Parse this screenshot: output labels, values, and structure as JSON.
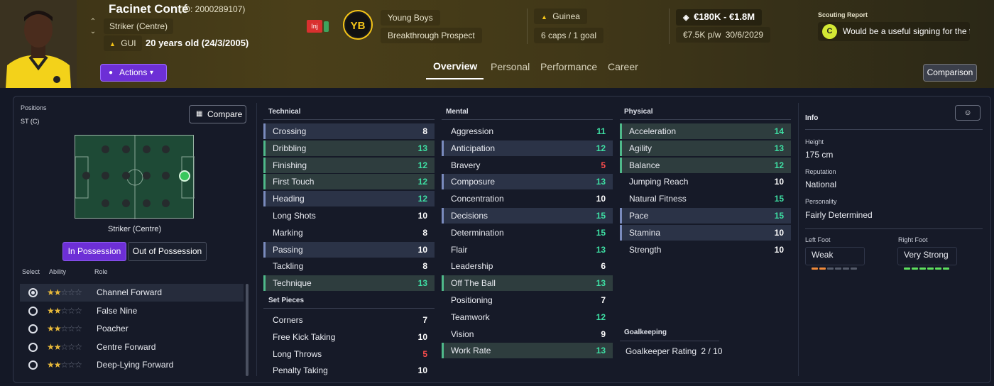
{
  "player": {
    "name": "Facinet Conté",
    "id_text": "(ID: 2000289107)",
    "position": "Striker (Centre)",
    "nationality_code": "GUI",
    "age_text": "20 years old (24/3/2005)",
    "injury_label": "Inj"
  },
  "club": {
    "name": "Young Boys",
    "status": "Breakthrough Prospect",
    "badge_text": "YB"
  },
  "international": {
    "country": "Guinea",
    "caps": "6 caps / 1 goal"
  },
  "contract": {
    "value": "€180K - €1.8M",
    "wage": "€7.5K p/w",
    "expires": "30/6/2029"
  },
  "scouting": {
    "title": "Scouting Report",
    "grade": "C",
    "summary": "Would be a useful signing for the f..."
  },
  "actions_label": "Actions",
  "tabs": [
    "Overview",
    "Personal",
    "Performance",
    "Career"
  ],
  "comparison_label": "Comparison",
  "positions": {
    "title": "Positions",
    "value": "ST (C)",
    "compare_label": "Compare",
    "pitch_caption": "Striker (Centre)",
    "in_possession": "In Possession",
    "out_possession": "Out of Possession",
    "headers": {
      "select": "Select",
      "ability": "Ability",
      "role": "Role"
    },
    "roles": [
      {
        "name": "Channel Forward",
        "stars": 2,
        "selected": true
      },
      {
        "name": "False Nine",
        "stars": 2,
        "selected": false
      },
      {
        "name": "Poacher",
        "stars": 2,
        "selected": false
      },
      {
        "name": "Centre Forward",
        "stars": 2,
        "selected": false
      },
      {
        "name": "Deep-Lying Forward",
        "stars": 2,
        "selected": false
      }
    ]
  },
  "attributes": {
    "technical_title": "Technical",
    "technical": [
      {
        "name": "Crossing",
        "value": "8",
        "hl": "b"
      },
      {
        "name": "Dribbling",
        "value": "13",
        "hl": "g"
      },
      {
        "name": "Finishing",
        "value": "12",
        "hl": "g"
      },
      {
        "name": "First Touch",
        "value": "12",
        "hl": "g"
      },
      {
        "name": "Heading",
        "value": "12",
        "hl": "b"
      },
      {
        "name": "Long Shots",
        "value": "10",
        "hl": ""
      },
      {
        "name": "Marking",
        "value": "8",
        "hl": ""
      },
      {
        "name": "Passing",
        "value": "10",
        "hl": "b"
      },
      {
        "name": "Tackling",
        "value": "8",
        "hl": ""
      },
      {
        "name": "Technique",
        "value": "13",
        "hl": "g"
      }
    ],
    "setpieces_title": "Set Pieces",
    "setpieces": [
      {
        "name": "Corners",
        "value": "7",
        "hl": ""
      },
      {
        "name": "Free Kick Taking",
        "value": "10",
        "hl": ""
      },
      {
        "name": "Long Throws",
        "value": "5",
        "hl": ""
      },
      {
        "name": "Penalty Taking",
        "value": "10",
        "hl": ""
      }
    ],
    "mental_title": "Mental",
    "mental": [
      {
        "name": "Aggression",
        "value": "11",
        "hl": ""
      },
      {
        "name": "Anticipation",
        "value": "12",
        "hl": "b"
      },
      {
        "name": "Bravery",
        "value": "5",
        "hl": ""
      },
      {
        "name": "Composure",
        "value": "13",
        "hl": "b"
      },
      {
        "name": "Concentration",
        "value": "10",
        "hl": ""
      },
      {
        "name": "Decisions",
        "value": "15",
        "hl": "b"
      },
      {
        "name": "Determination",
        "value": "15",
        "hl": ""
      },
      {
        "name": "Flair",
        "value": "13",
        "hl": ""
      },
      {
        "name": "Leadership",
        "value": "6",
        "hl": ""
      },
      {
        "name": "Off The Ball",
        "value": "13",
        "hl": "g"
      },
      {
        "name": "Positioning",
        "value": "7",
        "hl": ""
      },
      {
        "name": "Teamwork",
        "value": "12",
        "hl": ""
      },
      {
        "name": "Vision",
        "value": "9",
        "hl": ""
      },
      {
        "name": "Work Rate",
        "value": "13",
        "hl": "g"
      }
    ],
    "physical_title": "Physical",
    "physical": [
      {
        "name": "Acceleration",
        "value": "14",
        "hl": "g"
      },
      {
        "name": "Agility",
        "value": "13",
        "hl": "g"
      },
      {
        "name": "Balance",
        "value": "12",
        "hl": "g"
      },
      {
        "name": "Jumping Reach",
        "value": "10",
        "hl": ""
      },
      {
        "name": "Natural Fitness",
        "value": "15",
        "hl": ""
      },
      {
        "name": "Pace",
        "value": "15",
        "hl": "b"
      },
      {
        "name": "Stamina",
        "value": "10",
        "hl": "b"
      },
      {
        "name": "Strength",
        "value": "10",
        "hl": ""
      }
    ],
    "goalkeeping_title": "Goalkeeping",
    "gk_rating_label": "Goalkeeper Rating",
    "gk_rating_value": "2 / 10"
  },
  "info": {
    "title": "Info",
    "height_label": "Height",
    "height": "175 cm",
    "reputation_label": "Reputation",
    "reputation": "National",
    "personality_label": "Personality",
    "personality": "Fairly Determined",
    "left_foot_label": "Left Foot",
    "left_foot": "Weak",
    "right_foot_label": "Right Foot",
    "right_foot": "Very Strong"
  },
  "colors": {
    "green": "#3ee0a4",
    "red": "#ff4d4d",
    "white": "#ffffff",
    "accent": "#6d2fd6"
  }
}
